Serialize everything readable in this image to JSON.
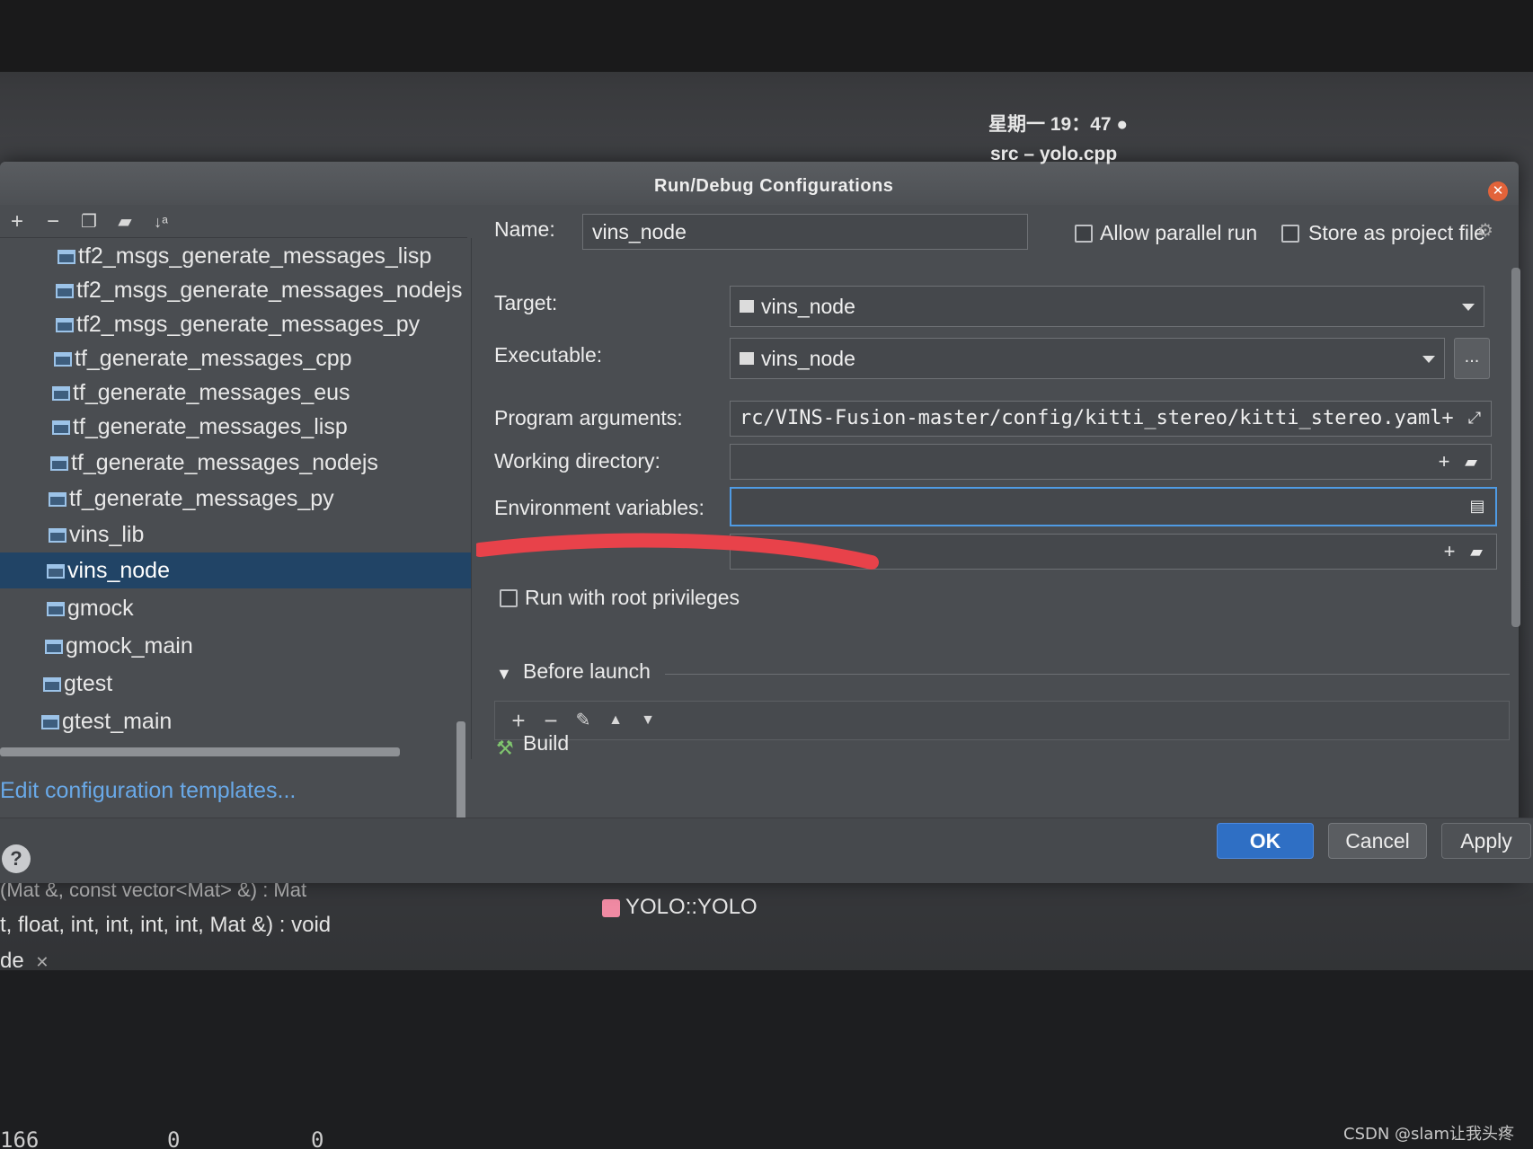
{
  "system": {
    "clock": "星期一 19：47 ●",
    "window_title": "src – yolo.cpp"
  },
  "dialog": {
    "title": "Run/Debug Configurations",
    "tree_items": [
      "tf2_msgs_generate_messages_lisp",
      "tf2_msgs_generate_messages_nodejs",
      "tf2_msgs_generate_messages_py",
      "tf_generate_messages_cpp",
      "tf_generate_messages_eus",
      "tf_generate_messages_lisp",
      "tf_generate_messages_nodejs",
      "tf_generate_messages_py",
      "vins_lib",
      "vins_node",
      "gmock",
      "gmock_main",
      "gtest",
      "gtest_main"
    ],
    "selected_item": "vins_node",
    "edit_templates": "Edit configuration templates...",
    "form": {
      "name_label": "Name:",
      "name_value": "vins_node",
      "allow_parallel": "Allow parallel run",
      "store_project": "Store as project file",
      "target_label": "Target:",
      "target_value": "vins_node",
      "executable_label": "Executable:",
      "executable_value": "vins_node",
      "browse": "...",
      "args_label": "Program arguments:",
      "args_value": "rc/VINS-Fusion-master/config/kitti_stereo/kitti_stereo.yaml",
      "workdir_label": "Working directory:",
      "workdir_value": "",
      "env_label": "Environment variables:",
      "env_value": "",
      "root_priv": "Run with root privileges",
      "before_launch": "Before launch",
      "build_item": "Build"
    },
    "buttons": {
      "ok": "OK",
      "cancel": "Cancel",
      "apply": "Apply",
      "help": "?"
    }
  },
  "background": {
    "line1": "(Mat &, const vector<Mat> &) : Mat",
    "line2": "t, float, int, int, int, int, Mat &) : void",
    "tab": "de",
    "symbol": "YOLO::YOLO",
    "bottom_values": [
      "166",
      "0",
      "0"
    ]
  },
  "watermark": "CSDN @slam让我头疼"
}
